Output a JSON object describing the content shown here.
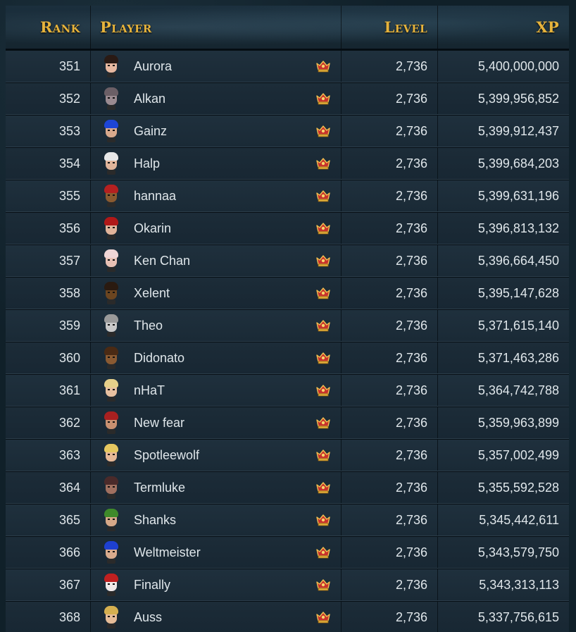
{
  "header": {
    "rank": "Rank",
    "player": "Player",
    "level": "Level",
    "xp": "XP"
  },
  "colors": {
    "header_text": "#e6b33c",
    "row_text": "#dfe6ea",
    "crown": "#c8322c"
  },
  "rows": [
    {
      "rank": "351",
      "name": "Aurora",
      "level": "2,736",
      "xp": "5,400,000,000",
      "hair": "#2a1a14",
      "skin": "#e7b8a0"
    },
    {
      "rank": "352",
      "name": "Alkan",
      "level": "2,736",
      "xp": "5,399,956,852",
      "hair": "#6b5f66",
      "skin": "#9a8a90"
    },
    {
      "rank": "353",
      "name": "Gainz",
      "level": "2,736",
      "xp": "5,399,912,437",
      "hair": "#1e45d6",
      "skin": "#d9a98c"
    },
    {
      "rank": "354",
      "name": "Halp",
      "level": "2,736",
      "xp": "5,399,684,203",
      "hair": "#e8e8e8",
      "skin": "#e0b49a"
    },
    {
      "rank": "355",
      "name": "hannaa",
      "level": "2,736",
      "xp": "5,399,631,196",
      "hair": "#b52020",
      "skin": "#8a5a30"
    },
    {
      "rank": "356",
      "name": "Okarin",
      "level": "2,736",
      "xp": "5,396,813,132",
      "hair": "#b01818",
      "skin": "#e1b39a"
    },
    {
      "rank": "357",
      "name": "Ken Chan",
      "level": "2,736",
      "xp": "5,396,664,450",
      "hair": "#f0d6d6",
      "skin": "#e8c1b5"
    },
    {
      "rank": "358",
      "name": "Xelent",
      "level": "2,736",
      "xp": "5,395,147,628",
      "hair": "#2a1a10",
      "skin": "#6b4520"
    },
    {
      "rank": "359",
      "name": "Theo",
      "level": "2,736",
      "xp": "5,371,615,140",
      "hair": "#9a9a9a",
      "skin": "#c8c8c8"
    },
    {
      "rank": "360",
      "name": "Didonato",
      "level": "2,736",
      "xp": "5,371,463,286",
      "hair": "#4a2a14",
      "skin": "#8a5a32"
    },
    {
      "rank": "361",
      "name": "nHaT",
      "level": "2,736",
      "xp": "5,364,742,788",
      "hair": "#e6d08a",
      "skin": "#e8c0a0"
    },
    {
      "rank": "362",
      "name": "New fear",
      "level": "2,736",
      "xp": "5,359,963,899",
      "hair": "#a82020",
      "skin": "#c89070"
    },
    {
      "rank": "363",
      "name": "Spotleewolf",
      "level": "2,736",
      "xp": "5,357,002,499",
      "hair": "#e6c860",
      "skin": "#e6b896"
    },
    {
      "rank": "364",
      "name": "Termluke",
      "level": "2,736",
      "xp": "5,355,592,528",
      "hair": "#4a2a2a",
      "skin": "#a07060"
    },
    {
      "rank": "365",
      "name": "Shanks",
      "level": "2,736",
      "xp": "5,345,442,611",
      "hair": "#3f8a2a",
      "skin": "#d6a888"
    },
    {
      "rank": "366",
      "name": "Weltmeister",
      "level": "2,736",
      "xp": "5,343,579,750",
      "hair": "#1e40d0",
      "skin": "#d8aa8c"
    },
    {
      "rank": "367",
      "name": "Finally",
      "level": "2,736",
      "xp": "5,343,313,113",
      "hair": "#c02020",
      "skin": "#f0e8e8"
    },
    {
      "rank": "368",
      "name": "Auss",
      "level": "2,736",
      "xp": "5,337,756,615",
      "hair": "#d6b050",
      "skin": "#e6bc98"
    }
  ]
}
